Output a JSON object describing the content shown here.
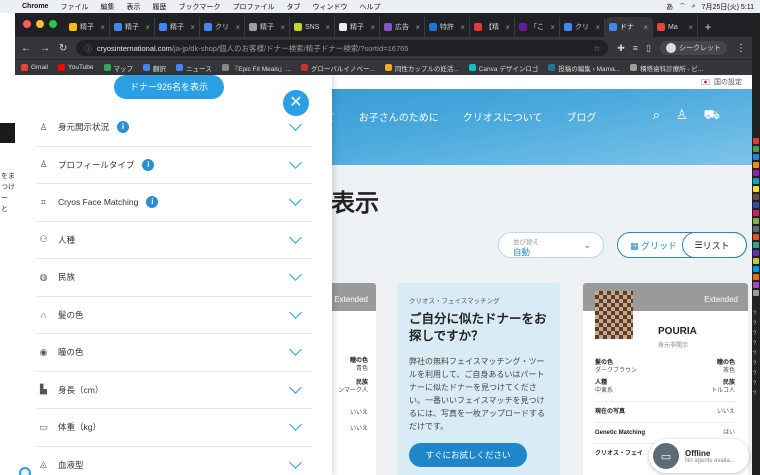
{
  "menubar": {
    "apple_icon": "apple-icon",
    "items": [
      "Chrome",
      "ファイル",
      "編集",
      "表示",
      "履歴",
      "ブックマーク",
      "プロファイル",
      "タブ",
      "ウィンドウ",
      "ヘルプ"
    ],
    "datetime": "7月25日(火) 5:11",
    "status": "あ"
  },
  "left_strip": {
    "lines": [
      "をま",
      "つけ",
      "ー と"
    ]
  },
  "tabs": [
    {
      "label": "精子",
      "icon_color": "#fbbc04"
    },
    {
      "label": "精子",
      "icon_color": "#4285f4"
    },
    {
      "label": "精子",
      "icon_color": "#4285f4"
    },
    {
      "label": "クリ",
      "icon_color": "#4285f4"
    },
    {
      "label": "精子",
      "icon_color": "#9aa0a6"
    },
    {
      "label": "SNS",
      "icon_color": "#c5d32a"
    },
    {
      "label": "精子",
      "icon_color": "#eeeeee"
    },
    {
      "label": "広告",
      "icon_color": "#7e57c2"
    },
    {
      "label": "特許",
      "icon_color": "#1976d2"
    },
    {
      "label": "【精",
      "icon_color": "#e53935"
    },
    {
      "label": "「こ",
      "icon_color": "#6a1b9a"
    },
    {
      "label": "クリ",
      "icon_color": "#4285f4"
    },
    {
      "label": "ドナ",
      "icon_color": "#4285f4",
      "active": true
    },
    {
      "label": "Ma",
      "icon_color": "#ea4335"
    }
  ],
  "toolbar": {
    "url_domain": "cryosinternational.com",
    "url_path": "/ja-jp/dk-shop/個人のお客様/ドナー検索/精子ドナー検索/?sortId=16765",
    "profile_label": "シークレット"
  },
  "bookmarks": [
    {
      "label": "Gmail",
      "color": "#ea4335"
    },
    {
      "label": "YouTube",
      "color": "#ff0000"
    },
    {
      "label": "マップ",
      "color": "#34a853"
    },
    {
      "label": "翻訳",
      "color": "#4285f4"
    },
    {
      "label": "ニュース",
      "color": "#4285f4"
    },
    {
      "label": "『Epic Fit Meals』...",
      "color": "#888888"
    },
    {
      "label": "グローバルイノベー...",
      "color": "#d32f2f"
    },
    {
      "label": "同性カップルの妊活...",
      "color": "#f9a825"
    },
    {
      "label": "Canva デザインロゴ",
      "color": "#00c4cc"
    },
    {
      "label": "投稿の編集 ‹ Mama...",
      "color": "#21759b"
    },
    {
      "label": "積塔歯科診療所 - ビ...",
      "color": "#9e9e9e"
    }
  ],
  "site": {
    "settings_label": "国の設定",
    "nav": [
      "いて",
      "お子さんのために",
      "クリオスについて",
      "ブログ"
    ],
    "heading": "表示",
    "sort_label": "並び替え",
    "sort_value": "自動",
    "grid_label": "グリッド",
    "list_label": "リスト"
  },
  "card1": {
    "badge": "Extended",
    "rows": [
      "瞳の色",
      "青色",
      "民族",
      "ンマーク人",
      "いいえ",
      "いいえ"
    ]
  },
  "card2": {
    "kicker": "クリオス・フェイスマッチング",
    "title": "ご自分に似たドナーをお探しですか？",
    "body": "弊社の無料フェイスマッチング・ツールを利用して、ご自身あるいはパートナーに似たドナーを見つけてください。一番いいフェイスマッチを見つけるには、写真を一枚アップロードするだけです。",
    "cta": "すぐにお試しください"
  },
  "card3": {
    "badge": "Extended",
    "name": "POURIA",
    "subtitle": "身元非開示",
    "rows": [
      {
        "l1": "髪の色",
        "v1": "ダークブラウン",
        "l2": "瞳の色",
        "v2": "茶色"
      },
      {
        "l1": "人種",
        "v1": "中東系",
        "l2": "民族",
        "v2": "トルコ人"
      }
    ],
    "lines": [
      {
        "l": "現在の写真",
        "v": "いいえ"
      },
      {
        "l": "Genetic Matching",
        "v": "はい"
      },
      {
        "l": "クリオス・フェイ",
        "v": ""
      }
    ]
  },
  "chat": {
    "title": "Offline",
    "subtitle": "No agents availa..."
  },
  "overlay": {
    "donor_count_button": "ドナー926名を表示",
    "filters": [
      {
        "label": "身元開示状況",
        "icon": "person-icon",
        "info": true
      },
      {
        "label": "プロフィールタイプ",
        "icon": "person-icon",
        "info": true
      },
      {
        "label": "Cryos Face Matching",
        "icon": "face-scan-icon",
        "info": true
      },
      {
        "label": "人種",
        "icon": "people-icon",
        "info": false
      },
      {
        "label": "民族",
        "icon": "globe-icon",
        "info": false
      },
      {
        "label": "髪の色",
        "icon": "hair-icon",
        "info": false
      },
      {
        "label": "瞳の色",
        "icon": "eye-icon",
        "info": false
      },
      {
        "label": "身長（cm）",
        "icon": "ruler-icon",
        "info": false
      },
      {
        "label": "体重（kg）",
        "icon": "scale-icon",
        "info": false
      },
      {
        "label": "血液型",
        "icon": "blood-drop-icon",
        "info": false
      }
    ]
  }
}
